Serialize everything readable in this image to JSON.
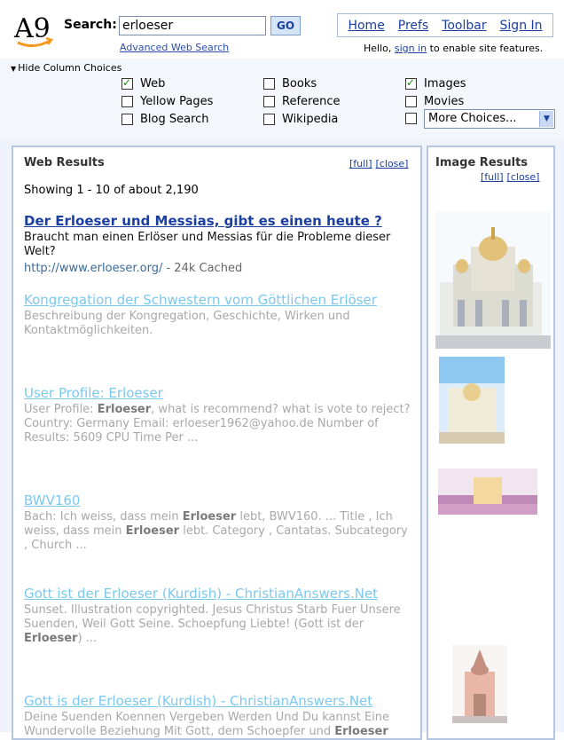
{
  "header": {
    "logo_text": "A9",
    "search_label": "Search:",
    "search_value": "erloeser",
    "go_label": "GO",
    "advanced_link": "Advanced Web Search",
    "nav": [
      "Home",
      "Prefs",
      "Toolbar",
      "Sign In"
    ],
    "hello_prefix": "Hello,",
    "hello_link": "sign in",
    "hello_suffix": "to enable site features."
  },
  "columns": {
    "toggle_label": "Hide Column Choices",
    "choices": [
      {
        "label": "Web",
        "checked": true
      },
      {
        "label": "Yellow Pages",
        "checked": false
      },
      {
        "label": "Blog Search",
        "checked": false
      },
      {
        "label": "Books",
        "checked": false
      },
      {
        "label": "Reference",
        "checked": false
      },
      {
        "label": "Wikipedia",
        "checked": false
      },
      {
        "label": "Images",
        "checked": true
      },
      {
        "label": "Movies",
        "checked": false
      }
    ],
    "more_choices": "More Choices..."
  },
  "web_results": {
    "title": "Web Results",
    "full_link": "[full]",
    "close_link": "[close]",
    "showing": "Showing 1 - 10 of about 2,190",
    "results": [
      {
        "title": "Der Erloeser und Messias, gibt es einen heute ?",
        "snippet": "Braucht man einen Erlöser und Messias für die Probleme dieser Welt?",
        "url": "http://www.erloeser.org/",
        "size": "24k",
        "cached": "Cached"
      },
      {
        "title": "Kongregation der Schwestern vom Göttlichen Erlöser",
        "snippet": "Beschreibung der Kongregation, Geschichte, Wirken und Kontaktmöglichkeiten."
      },
      {
        "title": "User Profile: Erloeser",
        "snippet_parts": [
          "User Profile: ",
          "Erloeser",
          ", what is recommend? what is vote to reject? Country: Germany Email: erloeser1962@yahoo.de Number of Results: 5609 CPU Time Per ..."
        ]
      },
      {
        "title": "BWV160",
        "snippet_parts": [
          "Bach: Ich weiss, dass mein ",
          "Erloeser",
          " lebt, BWV160. ... Title , Ich weiss, dass mein ",
          "Erloeser",
          " lebt. Category , Cantatas. Subcategory , Church ..."
        ]
      },
      {
        "title": "Gott ist der Erloeser (Kurdish) - ChristianAnswers.Net",
        "snippet_parts": [
          "Sunset. Illustration copyrighted. Jesus Christus Starb Fuer Unsere Suenden, Weil Gott Seine. Schoepfung Liebte! (Gott ist der ",
          "Erloeser",
          ") ..."
        ]
      },
      {
        "title": "Gott is der Erloeser (Kurdish) - ChristianAnswers.Net",
        "snippet_parts": [
          "Deine Suenden Koennen Vergeben Werden Und Du kannst Eine Wundervolle Beziehung Mit Gott, dem Schoepfer und ",
          "Erloeser"
        ]
      }
    ]
  },
  "image_results": {
    "title": "Image Results",
    "full_link": "[full]",
    "close_link": "[close]"
  },
  "colors": {
    "link": "#1a3fa0",
    "faded_link": "#7bc8f0",
    "panel_border": "#b4c6e2",
    "checkmark": "#1a8a1a"
  }
}
